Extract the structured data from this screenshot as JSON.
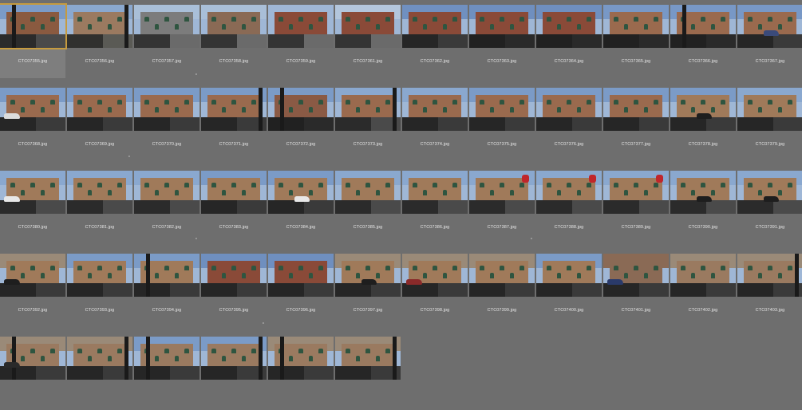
{
  "window": {
    "selected_index": 0
  },
  "photos": [
    {
      "file": "CTC07355.jpg",
      "sky": "#7b9bc7",
      "wall": "#8a5a40",
      "ground": "#4a4a4a",
      "pole": "yes",
      "car": "",
      "sign": ""
    },
    {
      "file": "CTC07356.jpg",
      "sky": "#8aa8cf",
      "wall": "#9b7a60",
      "ground": "#5a5a55",
      "pole": "yes",
      "car": "",
      "sign": ""
    },
    {
      "file": "CTC07357.jpg",
      "sky": "#a9bfd8",
      "wall": "#7c7c7c",
      "ground": "#6a6a6a",
      "pole": "",
      "car": "",
      "sign": ""
    },
    {
      "file": "CTC07358.jpg",
      "sky": "#a9bfd8",
      "wall": "#8a6a55",
      "ground": "#6a6a6a",
      "pole": "",
      "car": "",
      "sign": ""
    },
    {
      "file": "CTC07359.jpg",
      "sky": "#9fb7d6",
      "wall": "#8a4a38",
      "ground": "#6a6a6a",
      "pole": "",
      "car": "",
      "sign": ""
    },
    {
      "file": "CTC07361.jpg",
      "sky": "#b3c6dc",
      "wall": "#8a4a38",
      "ground": "#6a6a6a",
      "pole": "",
      "car": "",
      "sign": ""
    },
    {
      "file": "CTC07362.jpg",
      "sky": "#7090c0",
      "wall": "#8a4a38",
      "ground": "#3a3a3a",
      "pole": "",
      "car": "",
      "sign": ""
    },
    {
      "file": "CTC07363.jpg",
      "sky": "#6f8fbf",
      "wall": "#8a4a38",
      "ground": "#2a2a2a",
      "pole": "",
      "car": "",
      "sign": ""
    },
    {
      "file": "CTC07364.jpg",
      "sky": "#6f8fbf",
      "wall": "#8a4a38",
      "ground": "#2a2a2a",
      "pole": "",
      "car": "",
      "sign": ""
    },
    {
      "file": "CTC07365.jpg",
      "sky": "#7898c6",
      "wall": "#9a6a4e",
      "ground": "#2a2a2a",
      "pole": "",
      "car": "",
      "sign": ""
    },
    {
      "file": "CTC07366.jpg",
      "sky": "#7898c6",
      "wall": "#9a6a4e",
      "ground": "#2a2a2a",
      "pole": "yes",
      "car": "",
      "sign": ""
    },
    {
      "file": "CTC07367.jpg",
      "sky": "#7898c6",
      "wall": "#9a6a4e",
      "ground": "#3a3a3a",
      "pole": "",
      "car": "#3a4a7a",
      "sign": ""
    },
    {
      "file": "CTC07368.jpg",
      "sky": "#7b9bc7",
      "wall": "#9a6a4e",
      "ground": "#3a3a3a",
      "pole": "",
      "car": "#dcdcdc",
      "sign": ""
    },
    {
      "file": "CTC07369.jpg",
      "sky": "#7b9bc7",
      "wall": "#9a6a4e",
      "ground": "#3a3a3a",
      "pole": "",
      "car": "",
      "sign": ""
    },
    {
      "file": "CTC07370.jpg",
      "sky": "#7b9bc7",
      "wall": "#9a6a4e",
      "ground": "#3a3a3a",
      "pole": "",
      "car": "",
      "sign": ""
    },
    {
      "file": "CTC07371.jpg",
      "sky": "#7b9bc7",
      "wall": "#9a6a4e",
      "ground": "#3a3a3a",
      "pole": "yes",
      "car": "",
      "sign": ""
    },
    {
      "file": "CTC07372.jpg",
      "sky": "#7b9bc7",
      "wall": "#8a5a45",
      "ground": "#2a2a2a",
      "pole": "yes",
      "car": "",
      "sign": ""
    },
    {
      "file": "CTC07373.jpg",
      "sky": "#8aa8cf",
      "wall": "#9a6a4e",
      "ground": "#4a4a4a",
      "pole": "yes",
      "car": "",
      "sign": ""
    },
    {
      "file": "CTC07374.jpg",
      "sky": "#8aa8cf",
      "wall": "#9a6a4e",
      "ground": "#3a3a3a",
      "pole": "",
      "car": "",
      "sign": ""
    },
    {
      "file": "CTC07375.jpg",
      "sky": "#7b9bc7",
      "wall": "#9a6a4e",
      "ground": "#3a3a3a",
      "pole": "",
      "car": "",
      "sign": ""
    },
    {
      "file": "CTC07376.jpg",
      "sky": "#7b9bc7",
      "wall": "#9a6a4e",
      "ground": "#3a3a3a",
      "pole": "",
      "car": "",
      "sign": ""
    },
    {
      "file": "CTC07377.jpg",
      "sky": "#7b9bc7",
      "wall": "#9a6a4e",
      "ground": "#3a3a3a",
      "pole": "",
      "car": "",
      "sign": ""
    },
    {
      "file": "CTC07378.jpg",
      "sky": "#7b9bc7",
      "wall": "#a07a5a",
      "ground": "#3a3a3a",
      "pole": "",
      "car": "#1e1e1e",
      "sign": ""
    },
    {
      "file": "CTC07379.jpg",
      "sky": "#8aa8cf",
      "wall": "#a07a5a",
      "ground": "#3a3a3a",
      "pole": "",
      "car": "",
      "sign": ""
    },
    {
      "file": "CTC07380.jpg",
      "sky": "#8aa8cf",
      "wall": "#a07a5a",
      "ground": "#4a4a4a",
      "pole": "",
      "car": "#e8e8e8",
      "sign": ""
    },
    {
      "file": "CTC07381.jpg",
      "sky": "#8aa8cf",
      "wall": "#a07a5a",
      "ground": "#4a4a4a",
      "pole": "",
      "car": "",
      "sign": ""
    },
    {
      "file": "CTC07382.jpg",
      "sky": "#8aa8cf",
      "wall": "#a07a5a",
      "ground": "#4a4a4a",
      "pole": "",
      "car": "",
      "sign": ""
    },
    {
      "file": "CTC07383.jpg",
      "sky": "#7b9bc7",
      "wall": "#a07a5a",
      "ground": "#3a3a3a",
      "pole": "",
      "car": "",
      "sign": ""
    },
    {
      "file": "CTC07384.jpg",
      "sky": "#7b9bc7",
      "wall": "#a07a5a",
      "ground": "#3a3a3a",
      "pole": "",
      "car": "#e8e8e8",
      "sign": ""
    },
    {
      "file": "CTC07385.jpg",
      "sky": "#8aa8cf",
      "wall": "#a07a5a",
      "ground": "#4a4a4a",
      "pole": "",
      "car": "",
      "sign": ""
    },
    {
      "file": "CTC07386.jpg",
      "sky": "#8aa8cf",
      "wall": "#a07a5a",
      "ground": "#4a4a4a",
      "pole": "",
      "car": "",
      "sign": ""
    },
    {
      "file": "CTC07387.jpg",
      "sky": "#8aa8cf",
      "wall": "#a07a5a",
      "ground": "#4a4a4a",
      "pole": "",
      "car": "",
      "sign": "yes"
    },
    {
      "file": "CTC07388.jpg",
      "sky": "#8aa8cf",
      "wall": "#a07a5a",
      "ground": "#4a4a4a",
      "pole": "",
      "car": "",
      "sign": "yes"
    },
    {
      "file": "CTC07389.jpg",
      "sky": "#8aa8cf",
      "wall": "#a07a5a",
      "ground": "#4a4a4a",
      "pole": "",
      "car": "",
      "sign": "yes"
    },
    {
      "file": "CTC07390.jpg",
      "sky": "#8aa8cf",
      "wall": "#a07a5a",
      "ground": "#4a4a4a",
      "pole": "",
      "car": "#1e1e1e",
      "sign": ""
    },
    {
      "file": "CTC07391.jpg",
      "sky": "#8aa8cf",
      "wall": "#a07a5a",
      "ground": "#4a4a4a",
      "pole": "",
      "car": "#1e1e1e",
      "sign": ""
    },
    {
      "file": "CTC07392.jpg",
      "sky": "#9a8a78",
      "wall": "#a07a5a",
      "ground": "#3a3a3a",
      "pole": "",
      "car": "#1e1e1e",
      "sign": ""
    },
    {
      "file": "CTC07393.jpg",
      "sky": "#7b9bc7",
      "wall": "#a07a5a",
      "ground": "#3a3a3a",
      "pole": "",
      "car": "",
      "sign": ""
    },
    {
      "file": "CTC07394.jpg",
      "sky": "#7b9bc7",
      "wall": "#a07a5a",
      "ground": "#3a3a3a",
      "pole": "yes",
      "car": "",
      "sign": ""
    },
    {
      "file": "CTC07395.jpg",
      "sky": "#6f8fbf",
      "wall": "#8a4a38",
      "ground": "#3a3a3a",
      "pole": "",
      "car": "",
      "sign": ""
    },
    {
      "file": "CTC07396.jpg",
      "sky": "#6f8fbf",
      "wall": "#8a4a38",
      "ground": "#3a3a3a",
      "pole": "",
      "car": "",
      "sign": ""
    },
    {
      "file": "CTC07397.jpg",
      "sky": "#9a8a78",
      "wall": "#a07a5a",
      "ground": "#3a3a3a",
      "pole": "",
      "car": "#1e1e1e",
      "sign": ""
    },
    {
      "file": "CTC07398.jpg",
      "sky": "#9a8a78",
      "wall": "#a07a5a",
      "ground": "#3a3a3a",
      "pole": "",
      "car": "#8a2a2a",
      "sign": ""
    },
    {
      "file": "CTC07399.jpg",
      "sky": "#9a8a78",
      "wall": "#a07a5a",
      "ground": "#3a3a3a",
      "pole": "",
      "car": "",
      "sign": ""
    },
    {
      "file": "CTC07400.jpg",
      "sky": "#7b9bc7",
      "wall": "#a07a5a",
      "ground": "#3a3a3a",
      "pole": "",
      "car": "",
      "sign": ""
    },
    {
      "file": "CTC07401.jpg",
      "sky": "#8a6a55",
      "wall": "#8a6a55",
      "ground": "#3a3a3a",
      "pole": "",
      "car": "#2a3a6a",
      "sign": ""
    },
    {
      "file": "CTC07402.jpg",
      "sky": "#9a8a78",
      "wall": "#9a7a60",
      "ground": "#3a3a3a",
      "pole": "",
      "car": "",
      "sign": ""
    },
    {
      "file": "CTC07403.jpg",
      "sky": "#9a8a78",
      "wall": "#9a7a60",
      "ground": "#3a3a3a",
      "pole": "yes",
      "car": "",
      "sign": ""
    },
    {
      "file": "",
      "sky": "#9a8a78",
      "wall": "#9a7a60",
      "ground": "#3a3a3a",
      "pole": "yes",
      "car": "#2a2a2a",
      "sign": ""
    },
    {
      "file": "",
      "sky": "#9a8a78",
      "wall": "#9a7a60",
      "ground": "#3a3a3a",
      "pole": "yes",
      "car": "",
      "sign": ""
    },
    {
      "file": "",
      "sky": "#7b9bc7",
      "wall": "#9a7a60",
      "ground": "#3a3a3a",
      "pole": "yes",
      "car": "",
      "sign": ""
    },
    {
      "file": "",
      "sky": "#7b9bc7",
      "wall": "#9a7a60",
      "ground": "#3a3a3a",
      "pole": "yes",
      "car": "",
      "sign": ""
    },
    {
      "file": "",
      "sky": "#9a8a78",
      "wall": "#9a7a60",
      "ground": "#3a3a3a",
      "pole": "yes",
      "car": "",
      "sign": ""
    },
    {
      "file": "",
      "sky": "#9a8a78",
      "wall": "#9a7a60",
      "ground": "#3a3a3a",
      "pole": "yes",
      "car": "",
      "sign": ""
    }
  ]
}
